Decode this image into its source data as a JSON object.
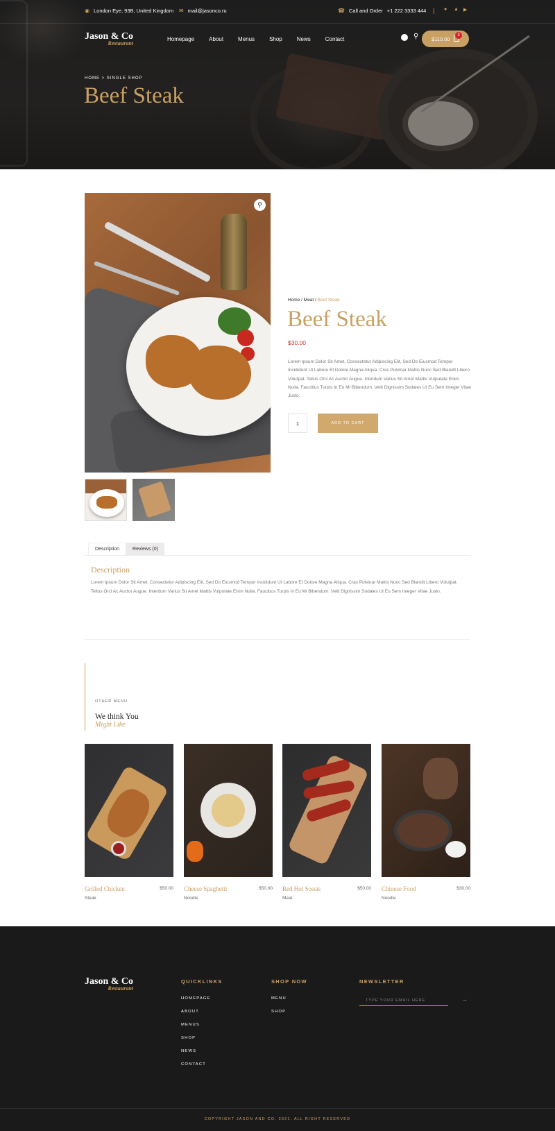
{
  "topbar": {
    "address": "London Eye, 93B, United Kingdom",
    "email": "mail@jasonco.ru",
    "call_label": "Call and Order",
    "phone": "+1 222 3333 444",
    "divider": "|",
    "social_icons": [
      "facebook-icon",
      "twitter-icon",
      "youtube-icon"
    ]
  },
  "brand": {
    "name": "Jason & Co",
    "tagline": "Restaurant"
  },
  "nav": {
    "items": [
      "Homepage",
      "About",
      "Menus",
      "Shop",
      "News",
      "Contact"
    ],
    "cart_total": "$110.00",
    "cart_count": "3"
  },
  "hero": {
    "breadcrumb": "HOME > SINGLE SHOP",
    "title": "Beef Steak"
  },
  "product": {
    "breadcrumb": {
      "home": "Home",
      "category": "Meat",
      "current": "Beef Steak",
      "sep": "/"
    },
    "title": "Beef Steak",
    "price": "$30.00",
    "description": "Lorem Ipsum Dolor Sit Amet, Consectetur Adipiscing Elit, Sed Do Eiusmod Tempor Incididunt Ut Labore Et Dolore Magna Aliqua. Cras Pulvinar Mattis Nunc Sed Blandit Libero Volutpat. Tellus Orci Ac Auctor Augue. Interdum Varius Sit Amet Mattis Vulputate Enim Nulla. Faucibus Turpis In Eu Mi Bibendum. Velit Dignissim Sodales Ut Eu Sem Integer Vitae Justo.",
    "quantity": "1",
    "add_to_cart": "ADD TO CART"
  },
  "tabs": {
    "items": [
      "Description",
      "Reviews (0)"
    ],
    "active": "Description",
    "content_title": "Description",
    "content_body": "Lorem Ipsum Dolor Sit Amet, Consectetur Adipiscing Elit, Sed Do Eiusmod Tempor Incididunt Ut Labore Et Dolore Magna Aliqua. Cras Pulvinar Mattis Nunc Sed Blandit Libero Volutpat. Tellus Orci Ac Auctor Augue. Interdum Varius Sit Amet Mattis Vulputate Enim Nulla. Faucibus Turpis In Eu Mi Bibendum. Velit Dignissim Sodales Ut Eu Sem Integer Vitae Justo."
  },
  "related": {
    "kicker": "OTHER MENU",
    "title": "We think You",
    "subtitle": "Might Like",
    "items": [
      {
        "name": "Grilled Chicken",
        "price": "$50.00",
        "category": "Steak"
      },
      {
        "name": "Cheese Spaghetti",
        "price": "$50.00",
        "category": "Noodle"
      },
      {
        "name": "Red Hot Sossis",
        "price": "$50.00",
        "category": "Meat"
      },
      {
        "name": "Chinese Food",
        "price": "$30.00",
        "category": "Noodle"
      }
    ]
  },
  "footer": {
    "quicklinks_title": "QUICKLINKS",
    "quicklinks": [
      "HOMEPAGE",
      "ABOUT",
      "MENUS",
      "SHOP",
      "NEWS",
      "CONTACT"
    ],
    "shop_title": "SHOP NOW",
    "shop_links": [
      "MENU",
      "SHOP"
    ],
    "newsletter_title": "NEWSLETTER",
    "newsletter_placeholder": "TYPE YOUR EMAIL HERE",
    "copyright": "COPYRIGHT JASON AND CO. 2021. ALL RIGHT RESERVED"
  },
  "colors": {
    "accent": "#c9a063",
    "price_red": "#c0392b",
    "footer_bg": "#1b1a1a"
  }
}
